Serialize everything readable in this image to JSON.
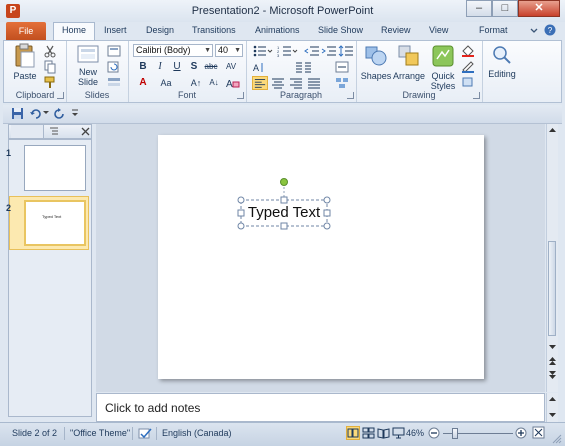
{
  "window": {
    "title": "Presentation2 - Microsoft PowerPoint",
    "minimize": "–",
    "maximize": "□",
    "close": "✕"
  },
  "tabs": [
    "File",
    "Home",
    "Insert",
    "Design",
    "Transitions",
    "Animations",
    "Slide Show",
    "Review",
    "View",
    "Format"
  ],
  "active_tab": "Home",
  "ribbon": {
    "clipboard": {
      "label": "Clipboard",
      "paste": "Paste"
    },
    "slides": {
      "label": "Slides",
      "new_slide_line1": "New",
      "new_slide_line2": "Slide"
    },
    "font": {
      "label": "Font",
      "font_name": "Calibri (Body)",
      "font_size": "40"
    },
    "paragraph": {
      "label": "Paragraph"
    },
    "drawing": {
      "label": "Drawing",
      "shapes": "Shapes",
      "arrange": "Arrange",
      "quick_styles_line1": "Quick",
      "quick_styles_line2": "Styles"
    },
    "editing": {
      "label": "Editing"
    }
  },
  "slides_pane": {
    "slides": [
      {
        "number": "1",
        "text": ""
      },
      {
        "number": "2",
        "text": "Typed Text"
      }
    ],
    "selected": 2
  },
  "slide": {
    "textbox_text": "Typed Text"
  },
  "notes": {
    "placeholder": "Click to add notes"
  },
  "statusbar": {
    "slide_info": "Slide 2 of 2",
    "theme": "\"Office Theme\"",
    "language": "English (Canada)",
    "zoom": "46%"
  },
  "colors": {
    "file_tab": "#d35a24",
    "selected_thumb": "#fce9b0",
    "handle_green": "#8ac53f"
  }
}
